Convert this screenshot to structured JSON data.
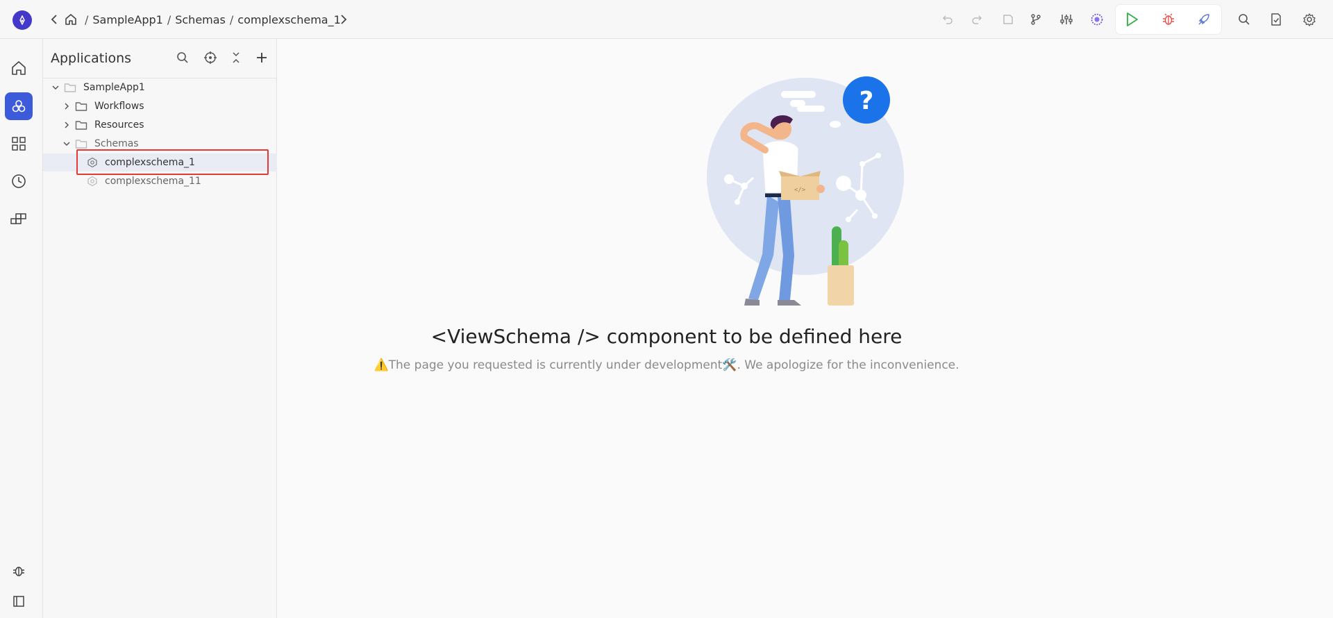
{
  "header": {
    "breadcrumb": [
      {
        "label": "SampleApp1"
      },
      {
        "label": "Schemas"
      },
      {
        "label": "complexschema_1"
      }
    ],
    "separator": "/"
  },
  "toolbar": {
    "icons": [
      "undo-icon",
      "redo-icon",
      "save-icon",
      "branch-icon",
      "sliders-icon",
      "ai-icon",
      "run-icon",
      "debug-icon",
      "deploy-icon",
      "search-icon",
      "checklist-icon",
      "settings-icon"
    ]
  },
  "rail": {
    "items": [
      "home-icon",
      "applications-icon",
      "dashboard-icon",
      "history-icon",
      "components-icon"
    ],
    "bottom": [
      "bug-icon",
      "layout-icon"
    ]
  },
  "explorer": {
    "title": "Applications",
    "tree": [
      {
        "label": "SampleApp1",
        "level": 0,
        "expanded": true,
        "type": "folder"
      },
      {
        "label": "Workflows",
        "level": 1,
        "expanded": false,
        "type": "folder"
      },
      {
        "label": "Resources",
        "level": 1,
        "expanded": false,
        "type": "folder"
      },
      {
        "label": "Schemas",
        "level": 1,
        "expanded": true,
        "type": "folder"
      },
      {
        "label": "complexschema_1",
        "level": 2,
        "type": "schema",
        "selected": true
      },
      {
        "label": "complexschema_11",
        "level": 2,
        "type": "schema"
      }
    ]
  },
  "main": {
    "title": "<ViewSchema /> component to be defined here",
    "warning_icon": "⚠️",
    "subtitle_part1": "The page you requested is currently under development",
    "tools_icon": "🛠️",
    "subtitle_part2": ". We apologize for the inconvenience."
  },
  "colors": {
    "accent": "#3b5bdb",
    "logo": "#4338ca",
    "highlight": "#e53935",
    "run": "#2fb344",
    "debug": "#e5534b",
    "deploy": "#5b7bd5"
  }
}
